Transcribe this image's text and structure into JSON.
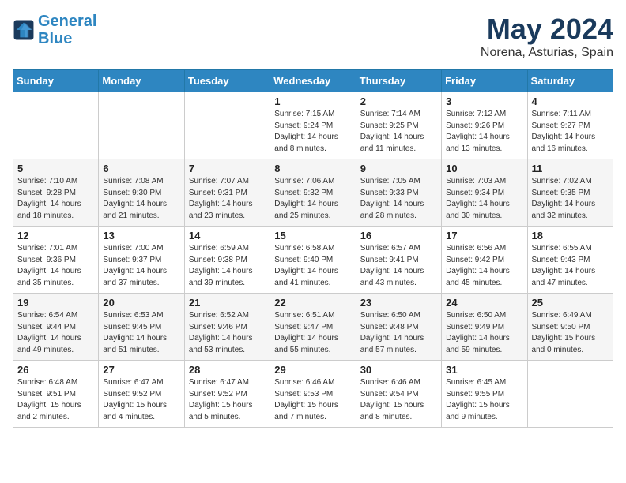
{
  "header": {
    "logo_line1": "General",
    "logo_line2": "Blue",
    "month": "May 2024",
    "location": "Norena, Asturias, Spain"
  },
  "weekdays": [
    "Sunday",
    "Monday",
    "Tuesday",
    "Wednesday",
    "Thursday",
    "Friday",
    "Saturday"
  ],
  "weeks": [
    [
      {
        "day": "",
        "content": ""
      },
      {
        "day": "",
        "content": ""
      },
      {
        "day": "",
        "content": ""
      },
      {
        "day": "1",
        "content": "Sunrise: 7:15 AM\nSunset: 9:24 PM\nDaylight: 14 hours\nand 8 minutes."
      },
      {
        "day": "2",
        "content": "Sunrise: 7:14 AM\nSunset: 9:25 PM\nDaylight: 14 hours\nand 11 minutes."
      },
      {
        "day": "3",
        "content": "Sunrise: 7:12 AM\nSunset: 9:26 PM\nDaylight: 14 hours\nand 13 minutes."
      },
      {
        "day": "4",
        "content": "Sunrise: 7:11 AM\nSunset: 9:27 PM\nDaylight: 14 hours\nand 16 minutes."
      }
    ],
    [
      {
        "day": "5",
        "content": "Sunrise: 7:10 AM\nSunset: 9:28 PM\nDaylight: 14 hours\nand 18 minutes."
      },
      {
        "day": "6",
        "content": "Sunrise: 7:08 AM\nSunset: 9:30 PM\nDaylight: 14 hours\nand 21 minutes."
      },
      {
        "day": "7",
        "content": "Sunrise: 7:07 AM\nSunset: 9:31 PM\nDaylight: 14 hours\nand 23 minutes."
      },
      {
        "day": "8",
        "content": "Sunrise: 7:06 AM\nSunset: 9:32 PM\nDaylight: 14 hours\nand 25 minutes."
      },
      {
        "day": "9",
        "content": "Sunrise: 7:05 AM\nSunset: 9:33 PM\nDaylight: 14 hours\nand 28 minutes."
      },
      {
        "day": "10",
        "content": "Sunrise: 7:03 AM\nSunset: 9:34 PM\nDaylight: 14 hours\nand 30 minutes."
      },
      {
        "day": "11",
        "content": "Sunrise: 7:02 AM\nSunset: 9:35 PM\nDaylight: 14 hours\nand 32 minutes."
      }
    ],
    [
      {
        "day": "12",
        "content": "Sunrise: 7:01 AM\nSunset: 9:36 PM\nDaylight: 14 hours\nand 35 minutes."
      },
      {
        "day": "13",
        "content": "Sunrise: 7:00 AM\nSunset: 9:37 PM\nDaylight: 14 hours\nand 37 minutes."
      },
      {
        "day": "14",
        "content": "Sunrise: 6:59 AM\nSunset: 9:38 PM\nDaylight: 14 hours\nand 39 minutes."
      },
      {
        "day": "15",
        "content": "Sunrise: 6:58 AM\nSunset: 9:40 PM\nDaylight: 14 hours\nand 41 minutes."
      },
      {
        "day": "16",
        "content": "Sunrise: 6:57 AM\nSunset: 9:41 PM\nDaylight: 14 hours\nand 43 minutes."
      },
      {
        "day": "17",
        "content": "Sunrise: 6:56 AM\nSunset: 9:42 PM\nDaylight: 14 hours\nand 45 minutes."
      },
      {
        "day": "18",
        "content": "Sunrise: 6:55 AM\nSunset: 9:43 PM\nDaylight: 14 hours\nand 47 minutes."
      }
    ],
    [
      {
        "day": "19",
        "content": "Sunrise: 6:54 AM\nSunset: 9:44 PM\nDaylight: 14 hours\nand 49 minutes."
      },
      {
        "day": "20",
        "content": "Sunrise: 6:53 AM\nSunset: 9:45 PM\nDaylight: 14 hours\nand 51 minutes."
      },
      {
        "day": "21",
        "content": "Sunrise: 6:52 AM\nSunset: 9:46 PM\nDaylight: 14 hours\nand 53 minutes."
      },
      {
        "day": "22",
        "content": "Sunrise: 6:51 AM\nSunset: 9:47 PM\nDaylight: 14 hours\nand 55 minutes."
      },
      {
        "day": "23",
        "content": "Sunrise: 6:50 AM\nSunset: 9:48 PM\nDaylight: 14 hours\nand 57 minutes."
      },
      {
        "day": "24",
        "content": "Sunrise: 6:50 AM\nSunset: 9:49 PM\nDaylight: 14 hours\nand 59 minutes."
      },
      {
        "day": "25",
        "content": "Sunrise: 6:49 AM\nSunset: 9:50 PM\nDaylight: 15 hours\nand 0 minutes."
      }
    ],
    [
      {
        "day": "26",
        "content": "Sunrise: 6:48 AM\nSunset: 9:51 PM\nDaylight: 15 hours\nand 2 minutes."
      },
      {
        "day": "27",
        "content": "Sunrise: 6:47 AM\nSunset: 9:52 PM\nDaylight: 15 hours\nand 4 minutes."
      },
      {
        "day": "28",
        "content": "Sunrise: 6:47 AM\nSunset: 9:52 PM\nDaylight: 15 hours\nand 5 minutes."
      },
      {
        "day": "29",
        "content": "Sunrise: 6:46 AM\nSunset: 9:53 PM\nDaylight: 15 hours\nand 7 minutes."
      },
      {
        "day": "30",
        "content": "Sunrise: 6:46 AM\nSunset: 9:54 PM\nDaylight: 15 hours\nand 8 minutes."
      },
      {
        "day": "31",
        "content": "Sunrise: 6:45 AM\nSunset: 9:55 PM\nDaylight: 15 hours\nand 9 minutes."
      },
      {
        "day": "",
        "content": ""
      }
    ]
  ]
}
